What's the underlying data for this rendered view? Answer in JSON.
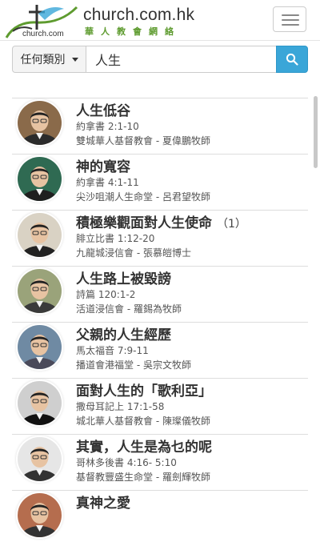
{
  "header": {
    "site_name": "church.com.hk",
    "site_sub": "華人教會網絡",
    "logo_text": "church.com"
  },
  "search": {
    "category_label": "任何類別",
    "query": "人生"
  },
  "sermons": [
    {
      "title": "人生低谷",
      "part": "",
      "ref": "約拿書 2:1-10",
      "church": "雙城華人基督教會 - 夏偉鵬牧師",
      "avatar_bg": "#8a6a4a",
      "shirt": "#2b2b2b"
    },
    {
      "title": "神的寬容",
      "part": "",
      "ref": "約拿書 4:1-11",
      "church": "尖沙咀潮人生命堂 - 呂君望牧師",
      "avatar_bg": "#2f6a52",
      "shirt": "#1f1f1f"
    },
    {
      "title": "積極樂觀面對人生使命",
      "part": "（1）",
      "ref": "腓立比書 1:12-20",
      "church": "九龍城浸信會 - 張慕皚博士",
      "avatar_bg": "#d9d2c4",
      "shirt": "#222"
    },
    {
      "title": "人生路上被毀謗",
      "part": "",
      "ref": "詩篇 120:1-2",
      "church": "活道浸信會 - 羅錫為牧師",
      "avatar_bg": "#9aa37a",
      "shirt": "#3a3a3a"
    },
    {
      "title": "父親的人生經歷",
      "part": "",
      "ref": "馬太福音 7:9-11",
      "church": "播道會港福堂 - 吳宗文牧師",
      "avatar_bg": "#6f8aa3",
      "shirt": "#4a4a5a"
    },
    {
      "title": "面對人生的「歌利亞」",
      "part": "",
      "ref": "撒母耳記上 17:1-58",
      "church": "城北華人基督教會 - 陳璨儀牧師",
      "avatar_bg": "#cfcfcf",
      "shirt": "#111"
    },
    {
      "title": "其實，人生是為乜的呢",
      "part": "",
      "ref": "哥林多後書 4:16- 5:10",
      "church": "基督教豐盛生命堂 - 羅劍輝牧師",
      "avatar_bg": "#e6e6e6",
      "shirt": "#333"
    },
    {
      "title": "真神之愛",
      "part": "",
      "ref": "",
      "church": "",
      "avatar_bg": "#b56d4e",
      "shirt": "#333"
    }
  ],
  "colors": {
    "accent": "#3aa6d8",
    "brand_green": "#5e9b2f"
  }
}
